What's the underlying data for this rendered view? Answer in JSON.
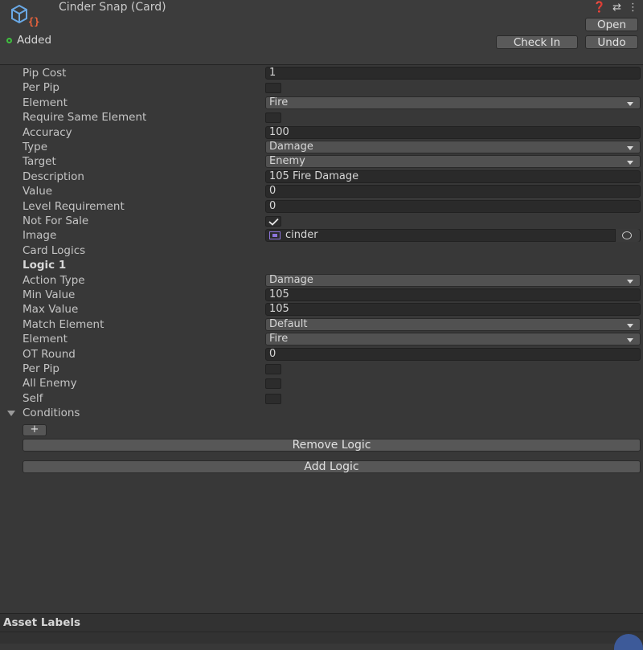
{
  "header": {
    "title": "Cinder Snap (Card)",
    "status": "Added",
    "icons": [
      "help-icon",
      "settings-sliders-icon",
      "more-options-icon"
    ],
    "buttons": {
      "open": "Open",
      "check_in": "Check In",
      "undo": "Undo"
    }
  },
  "fields": [
    {
      "label": "Pip Cost",
      "kind": "text",
      "value": "1"
    },
    {
      "label": "Per Pip",
      "kind": "checkbox",
      "checked": false
    },
    {
      "label": "Element",
      "kind": "dropdown",
      "value": "Fire"
    },
    {
      "label": "Require Same Element",
      "kind": "checkbox",
      "checked": false
    },
    {
      "label": "Accuracy",
      "kind": "text",
      "value": "100"
    },
    {
      "label": "Type",
      "kind": "dropdown",
      "value": "Damage"
    },
    {
      "label": "Target",
      "kind": "dropdown",
      "value": "Enemy"
    },
    {
      "label": "Description",
      "kind": "text",
      "value": "105 Fire Damage"
    },
    {
      "label": "Value",
      "kind": "text",
      "value": "0"
    },
    {
      "label": "Level Requirement",
      "kind": "text",
      "value": "0"
    },
    {
      "label": "Not For Sale",
      "kind": "checkbox",
      "checked": true
    },
    {
      "label": "Image",
      "kind": "object",
      "value": "cinder"
    },
    {
      "label": "Card Logics",
      "kind": "header"
    },
    {
      "label": "Logic 1",
      "kind": "header-bold"
    },
    {
      "label": "Action Type",
      "kind": "dropdown",
      "value": "Damage"
    },
    {
      "label": "Min Value",
      "kind": "text",
      "value": "105"
    },
    {
      "label": "Max Value",
      "kind": "text",
      "value": "105"
    },
    {
      "label": "Match Element",
      "kind": "dropdown",
      "value": "Default"
    },
    {
      "label": "Element",
      "kind": "dropdown",
      "value": "Fire"
    },
    {
      "label": "OT Round",
      "kind": "text",
      "value": "0"
    },
    {
      "label": "Per Pip",
      "kind": "checkbox",
      "checked": false
    },
    {
      "label": "All Enemy",
      "kind": "checkbox",
      "checked": false
    },
    {
      "label": "Self",
      "kind": "checkbox",
      "checked": false
    },
    {
      "label": "Conditions",
      "kind": "foldout"
    }
  ],
  "buttons": {
    "add_condition": "+",
    "remove_logic": "Remove Logic",
    "add_logic": "Add Logic"
  },
  "footer": {
    "asset_labels": "Asset Labels"
  },
  "colors": {
    "panel_bg": "#383838",
    "field_bg": "#2a2a2a",
    "dropdown_bg": "#515151",
    "button_bg": "#575757",
    "status_green": "#3fbf3f"
  }
}
